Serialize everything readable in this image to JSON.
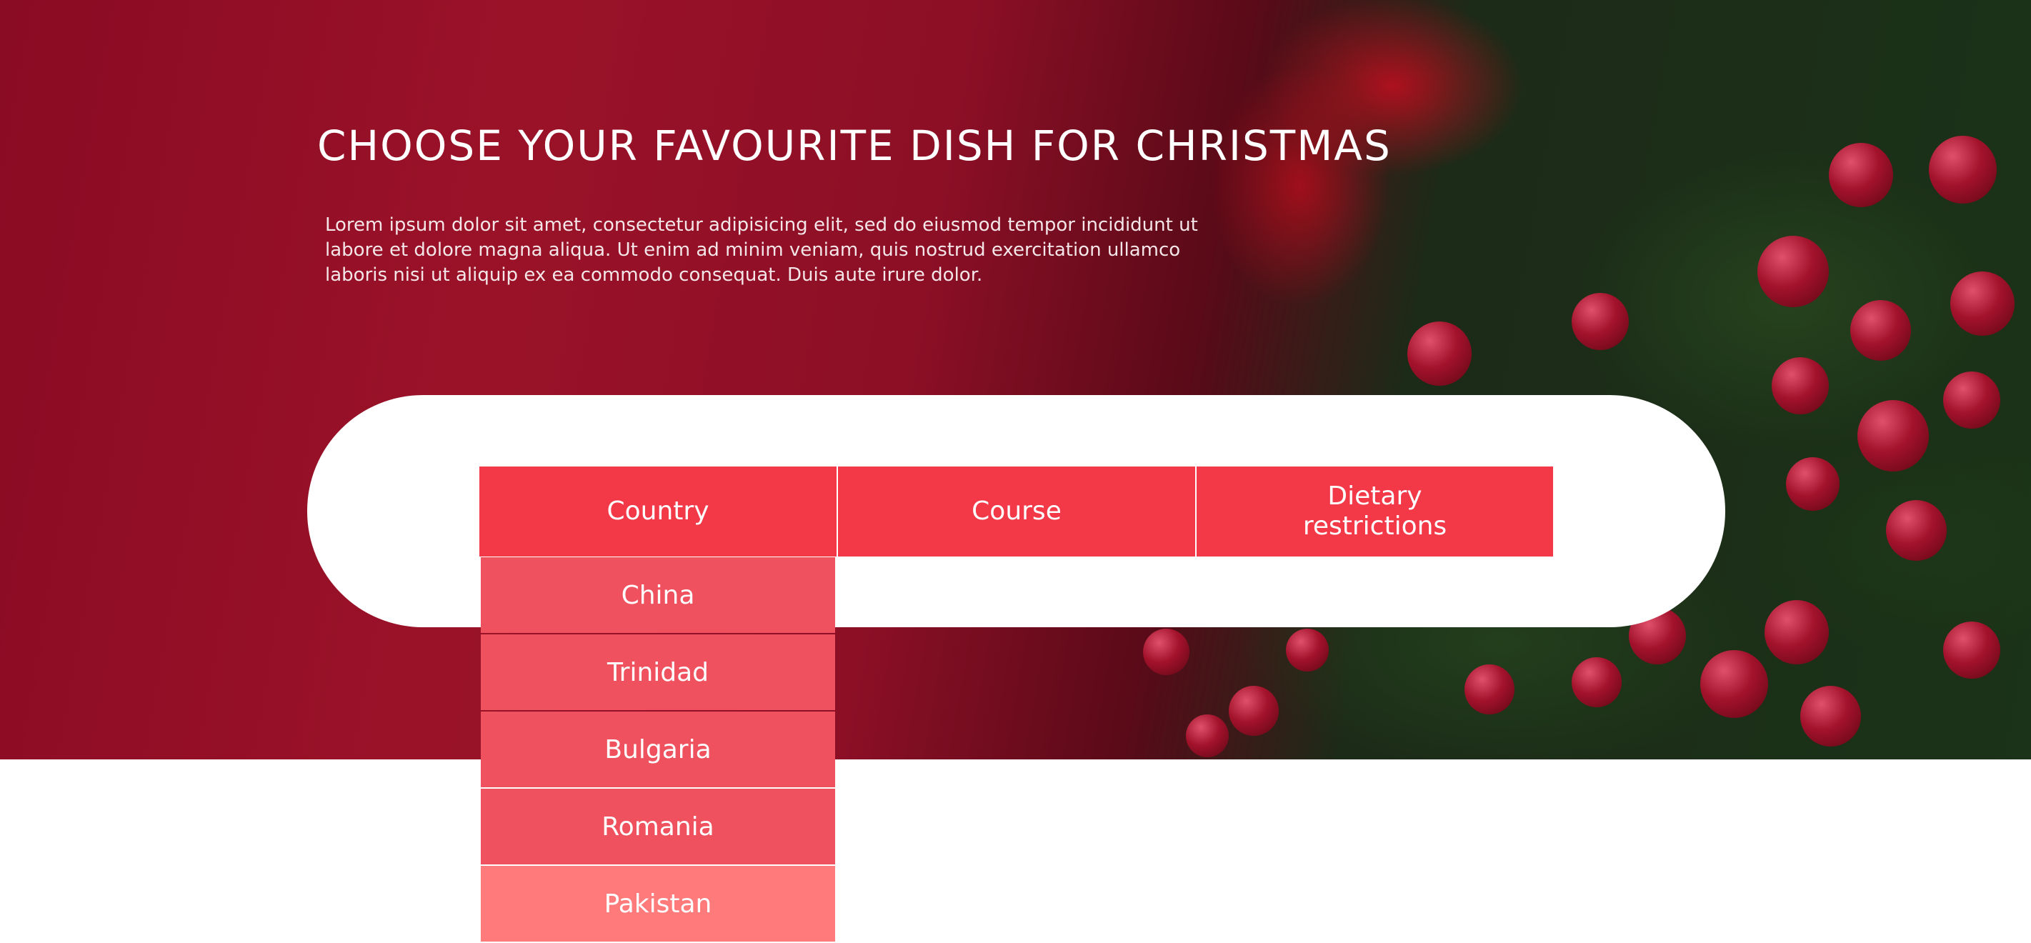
{
  "hero": {
    "title": "CHOOSE YOUR FAVOURITE DISH FOR CHRISTMAS",
    "description": "Lorem ipsum dolor sit amet, consectetur adipisicing elit, sed do eiusmod tempor incididunt ut labore et dolore magna aliqua. Ut enim ad minim veniam, quis nostrud exercitation ullamco laboris nisi ut aliquip ex ea commodo consequat. Duis aute irure dolor."
  },
  "filters": {
    "country": "Country",
    "course": "Course",
    "dietary": "Dietary restrictions"
  },
  "country_options": [
    "China",
    "Trinidad",
    "Bulgaria",
    "Romania",
    "Pakistan"
  ],
  "colors": {
    "hero_red": "#8a0b24",
    "tab_red": "#f33848",
    "option_red": "#ef525e",
    "option_hover": "#ff7a7b"
  }
}
